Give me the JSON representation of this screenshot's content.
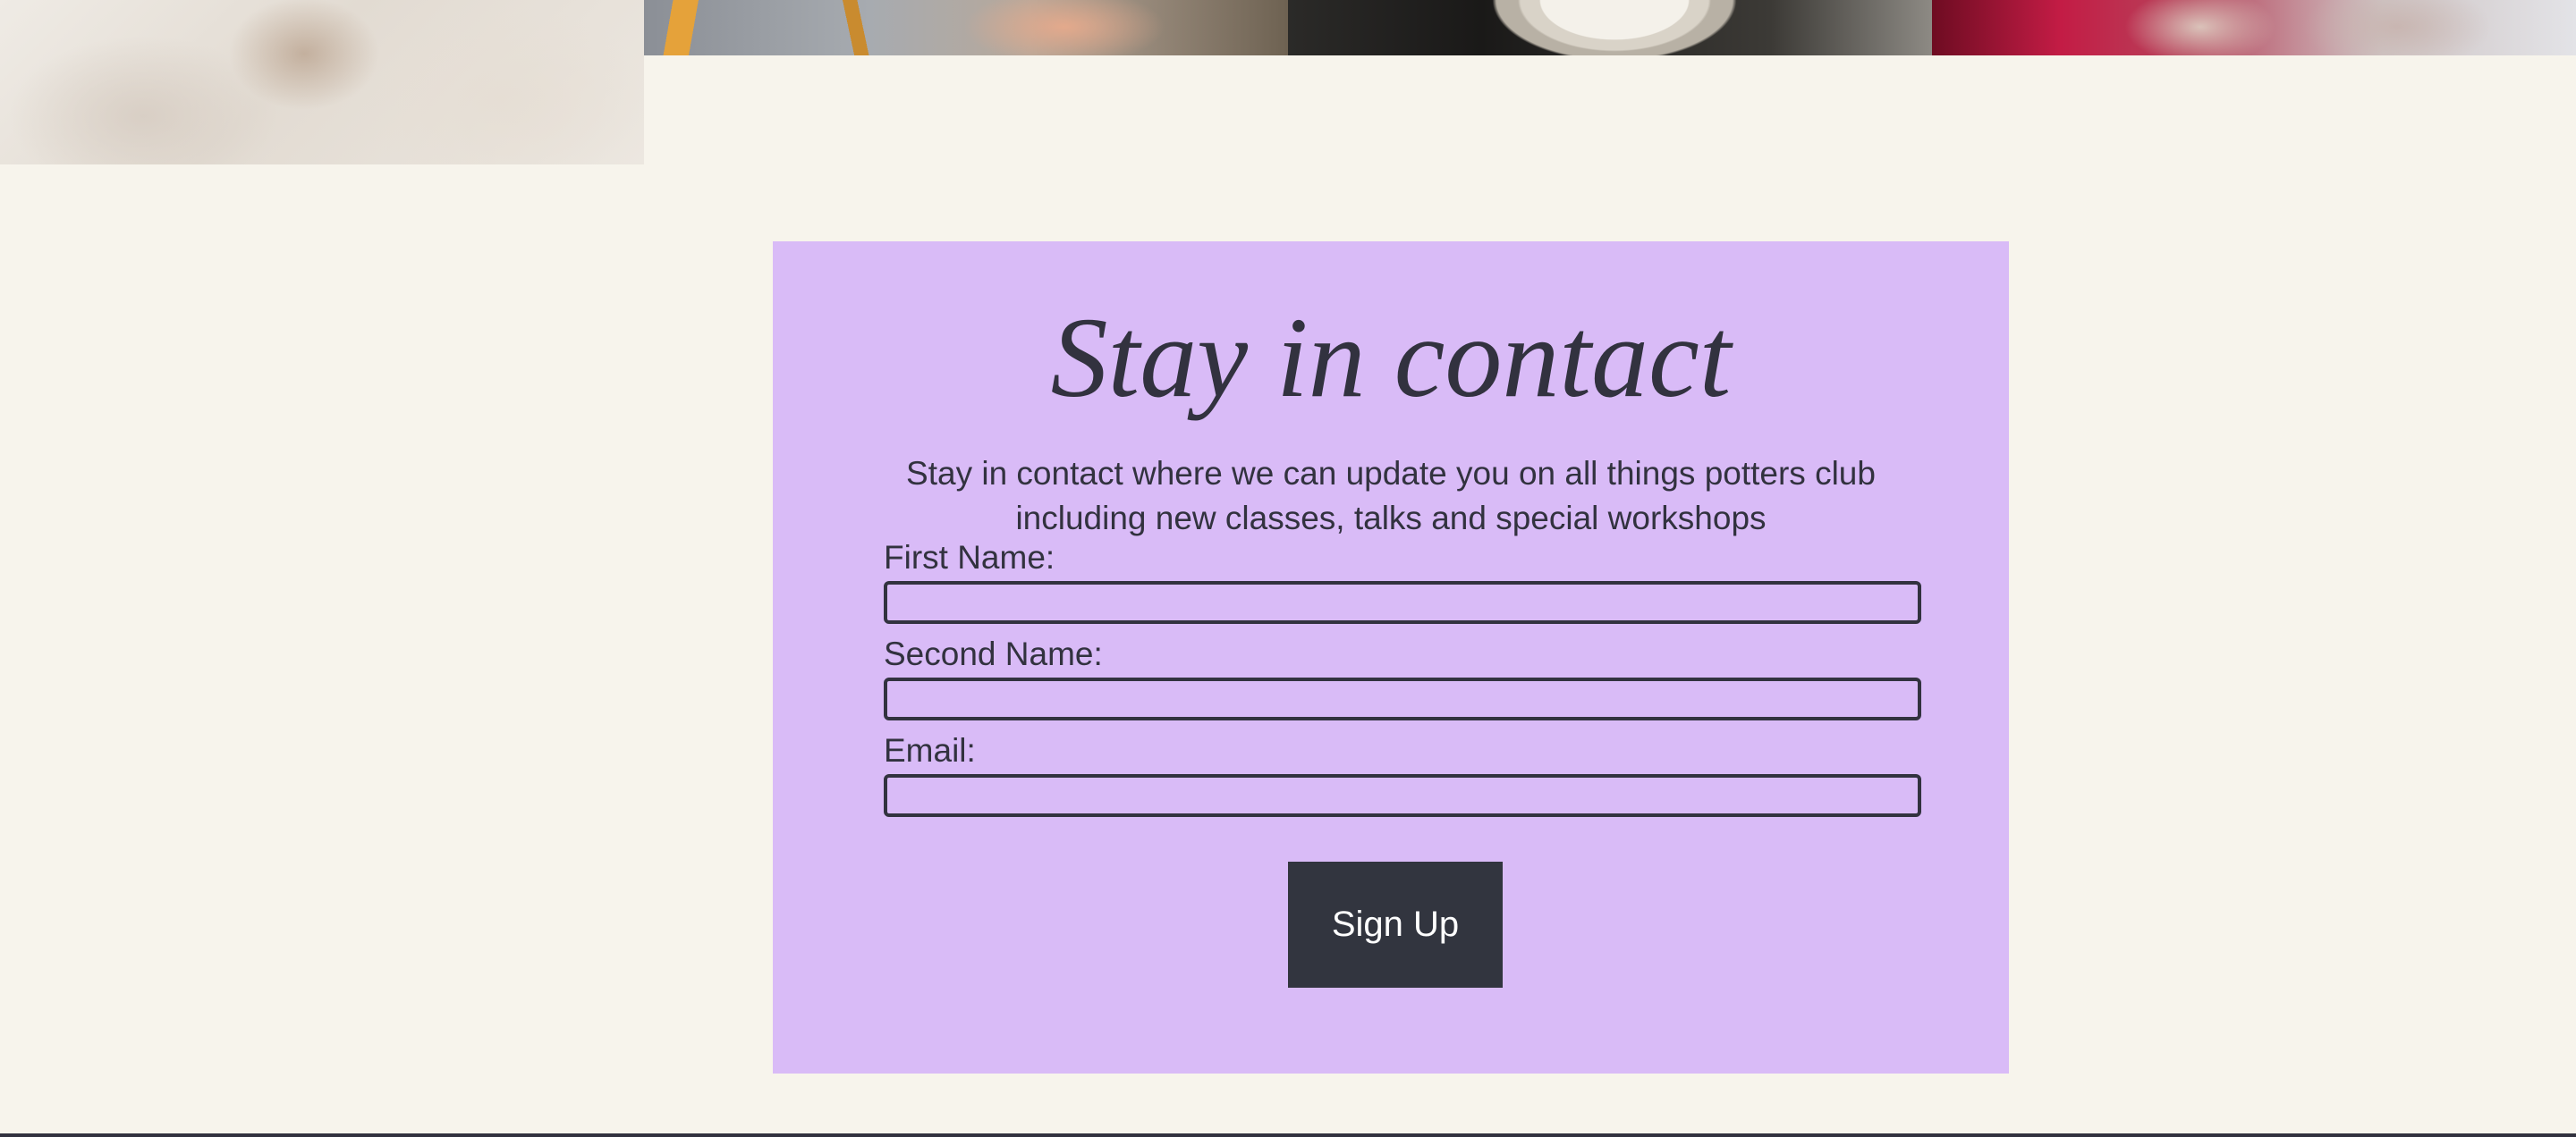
{
  "header_gallery": {
    "images": [
      {
        "subject": "clay-texture-photo"
      },
      {
        "subject": "pottery-tools-photo"
      },
      {
        "subject": "pottery-wheel-photo"
      },
      {
        "subject": "ceramic-bowl-photo"
      }
    ]
  },
  "contact": {
    "title": "Stay in contact",
    "intro": "Stay in contact where we can update you on all things potters club including new classes, talks and special workshops",
    "fields": [
      {
        "label": "First Name:",
        "value": ""
      },
      {
        "label": "Second Name:",
        "value": ""
      },
      {
        "label": "Email:",
        "value": ""
      }
    ],
    "submit_label": "Sign Up"
  },
  "colors": {
    "page_background": "#f7f4ec",
    "card_background": "#d9bbf7",
    "text": "#32323f",
    "button_background": "#32353f",
    "button_text": "#ffffff"
  }
}
